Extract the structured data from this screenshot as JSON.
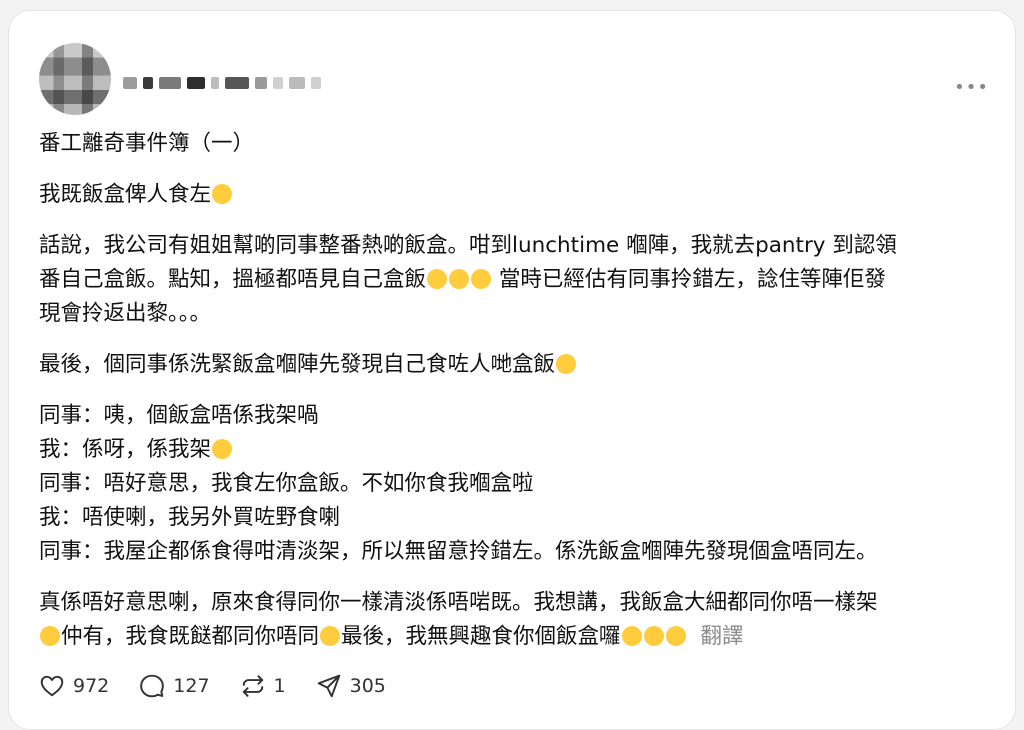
{
  "post": {
    "author_name_redacted": "█████",
    "more_icon": "more-horizontal-icon",
    "title": "番工離奇事件簿（一）",
    "line2": "我既飯盒俾人食左",
    "para1": {
      "l1": "話說，我公司有姐姐幫啲同事整番熱啲飯盒。咁到lunchtime 嗰陣，我就去pantry 到認領",
      "l2a": "番自己盒飯。點知，搵極都唔見自己盒飯",
      "l2b": "當時已經估有同事拎錯左，諗住等陣佢發",
      "l3": "現會拎返出黎。。。"
    },
    "para2": "最後，個同事係洗緊飯盒嗰陣先發現自己食咗人哋盒飯",
    "dialog": {
      "d1": "同事：咦，個飯盒唔係我架喎",
      "d2": "我：係呀，係我架",
      "d3": "同事：唔好意思，我食左你盒飯。不如你食我嗰盒啦",
      "d4": "我：唔使喇，我另外買咗野食喇",
      "d5": "同事：我屋企都係食得咁清淡架，所以無留意拎錯左。係洗飯盒嗰陣先發現個盒唔同左。"
    },
    "para3": {
      "l1": "真係唔好意思喇，原來食得同你一樣清淡係唔啱既。我想講，我飯盒大細都同你唔一樣架",
      "l2a": "仲有，我食既餸都同你唔同",
      "l2b": "最後，我無興趣食你個飯盒囉",
      "translate": "翻譯"
    }
  },
  "actions": {
    "like_count": "972",
    "comment_count": "127",
    "repost_count": "1",
    "share_count": "305"
  },
  "colors": {
    "background": "#f3f3f3",
    "card": "#ffffff",
    "text": "#111111",
    "muted": "#8a8a8a",
    "emoji": "#ffcc3e"
  }
}
